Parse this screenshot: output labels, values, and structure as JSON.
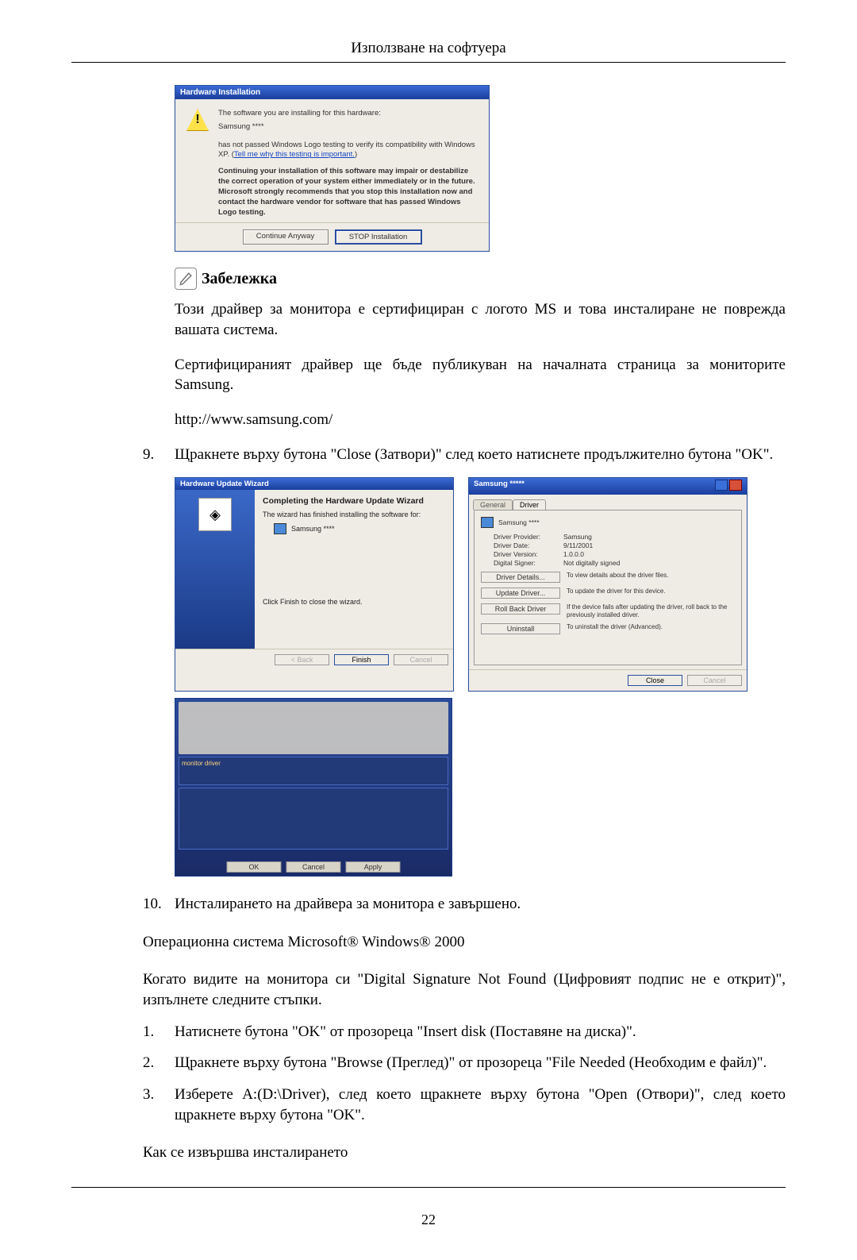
{
  "header": {
    "title": "Използване на софтуера"
  },
  "dlg1": {
    "title": "Hardware Installation",
    "line1": "The software you are installing for this hardware:",
    "device": "Samsung ****",
    "line2a": "has not passed Windows Logo testing to verify its compatibility with Windows XP. (",
    "link": "Tell me why this testing is important.",
    "line2b": ")",
    "bold": "Continuing your installation of this software may impair or destabilize the correct operation of your system either immediately or in the future. Microsoft strongly recommends that you stop this installation now and contact the hardware vendor for software that has passed Windows Logo testing.",
    "btn_continue": "Continue Anyway",
    "btn_stop": "STOP Installation"
  },
  "note": {
    "label": "Забележка"
  },
  "p1": "Този драйвер за монитора е сертифициран с логото MS и това инсталиране не поврежда вашата система.",
  "p2": "Сертифицираният драйвер ще бъде публикуван на началната страница за мониторите Samsung.",
  "p3": "http://www.samsung.com/",
  "step9": {
    "num": "9.",
    "text": "Щракнете върху бутона \"Close (Затвори)\" след което натиснете продължително бутона \"OK\"."
  },
  "wiz": {
    "title": "Hardware Update Wizard",
    "h": "Completing the Hardware Update Wizard",
    "line1": "The wizard has finished installing the software for:",
    "device": "Samsung ****",
    "line2": "Click Finish to close the wizard.",
    "back": "< Back",
    "finish": "Finish",
    "cancel": "Cancel"
  },
  "prop": {
    "title": "Samsung *****",
    "tab_general": "General",
    "tab_driver": "Driver",
    "device": "Samsung ****",
    "kv": {
      "prov_k": "Driver Provider:",
      "prov_v": "Samsung",
      "date_k": "Driver Date:",
      "date_v": "9/11/2001",
      "ver_k": "Driver Version:",
      "ver_v": "1.0.0.0",
      "sig_k": "Digital Signer:",
      "sig_v": "Not digitally signed"
    },
    "b1": "Driver Details...",
    "d1": "To view details about the driver files.",
    "b2": "Update Driver...",
    "d2": "To update the driver for this device.",
    "b3": "Roll Back Driver",
    "d3": "If the device fails after updating the driver, roll back to the previously installed driver.",
    "b4": "Uninstall",
    "d4": "To uninstall the driver (Advanced).",
    "close": "Close",
    "cancel": "Cancel"
  },
  "dispprops": {
    "ok": "OK",
    "cancel": "Cancel",
    "apply": "Apply"
  },
  "step10": {
    "num": "10.",
    "text": "Инсталирането на драйвера за монитора е завършено."
  },
  "os_line": "Операционна система Microsoft® Windows® 2000",
  "p4": "Когато видите на монитора си \"Digital Signature Not Found (Цифровият подпис не е открит)\", изпълнете следните стъпки.",
  "s1": {
    "num": "1.",
    "text": "Натиснете бутона \"OK\" от прозореца \"Insert disk (Поставяне на диска)\"."
  },
  "s2": {
    "num": "2.",
    "text": "Щракнете върху бутона \"Browse (Преглед)\" от прозореца \"File Needed (Необходим е файл)\"."
  },
  "s3": {
    "num": "3.",
    "text": "Изберете A:(D:\\Driver), след което щракнете върху бутона \"Open (Отвори)\", след което щракнете върху бутона \"OK\"."
  },
  "p5": "Как се извършва инсталирането",
  "footer": {
    "page": "22"
  }
}
